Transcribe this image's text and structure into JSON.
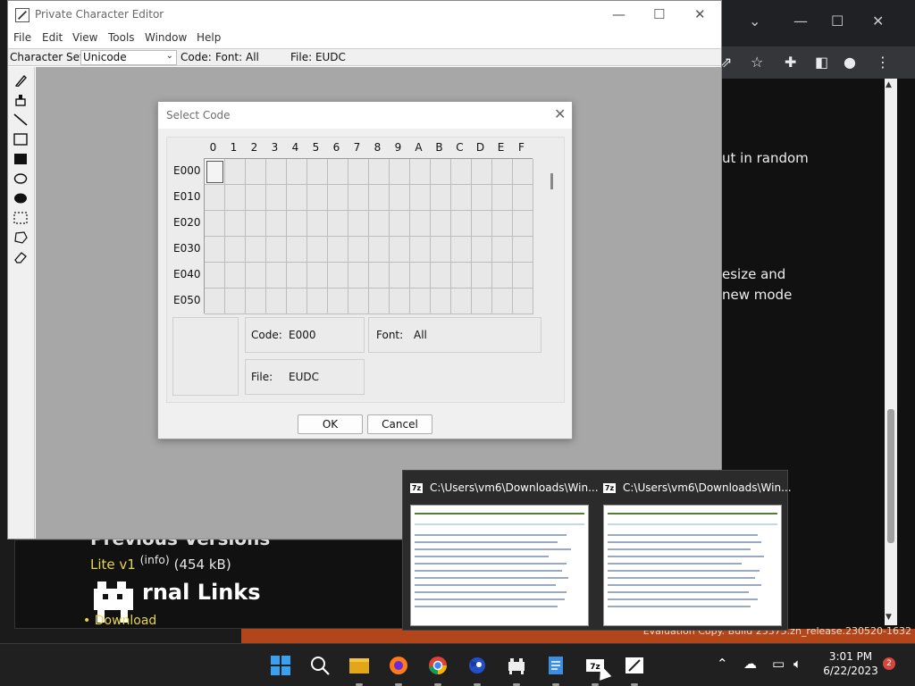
{
  "pce": {
    "title": "Private Character Editor",
    "menus": [
      "File",
      "Edit",
      "View",
      "Tools",
      "Window",
      "Help"
    ],
    "status": {
      "charset_label": "Character Set:",
      "charset_value": "Unicode",
      "code_label": "Code:",
      "font_label": "Font: All",
      "file_label": "File: EUDC"
    },
    "tools": [
      "pencil-icon",
      "brush-icon",
      "line-icon",
      "hollow-rectangle-icon",
      "filled-rectangle-icon",
      "hollow-ellipse-icon",
      "filled-ellipse-icon",
      "rectangular-selection-icon",
      "freeform-selection-icon",
      "eraser-icon"
    ]
  },
  "dialog": {
    "title": "Select Code",
    "columns": [
      "0",
      "1",
      "2",
      "3",
      "4",
      "5",
      "6",
      "7",
      "8",
      "9",
      "A",
      "B",
      "C",
      "D",
      "E",
      "F"
    ],
    "rows": [
      "E000",
      "E010",
      "E020",
      "E030",
      "E040",
      "E050"
    ],
    "selected_cell": "E000",
    "info": {
      "code_label": "Code:",
      "code_value": "E000",
      "font_label": "Font:",
      "font_value": "All",
      "file_label": "File:",
      "file_value": "EUDC"
    },
    "ok_label": "OK",
    "cancel_label": "Cancel"
  },
  "browser": {
    "text_lines": [
      "ut in random",
      "esize and",
      "new mode"
    ],
    "lower": {
      "section_title": "Previous Versions",
      "lite_link": "Lite v1",
      "info_link": "(info)",
      "lite_size": "(454 kB)",
      "external_title": "rnal Links",
      "download_link": "Download"
    },
    "eval_text": "Evaluation Copy. Build 25375.zn_release.230520-1632"
  },
  "thumbnails": [
    {
      "title": "C:\\Users\\vm6\\Downloads\\Win..."
    },
    {
      "title": "C:\\Users\\vm6\\Downloads\\Win..."
    }
  ],
  "taskbar": {
    "apps": [
      "start-icon",
      "search-icon",
      "file-explorer-icon",
      "firefox-icon",
      "chrome-icon",
      "sonic-icon",
      "game-icon",
      "notepad-icon",
      "7zip-icon",
      "private-character-editor-icon"
    ],
    "time": "3:01 PM",
    "date": "6/22/2023",
    "notification_count": "2"
  },
  "colors": {
    "workarea": "#a7a7a7",
    "dialog_bg": "#f0f0f0",
    "taskbar_bg": "#202020",
    "badge": "#d7463c"
  }
}
